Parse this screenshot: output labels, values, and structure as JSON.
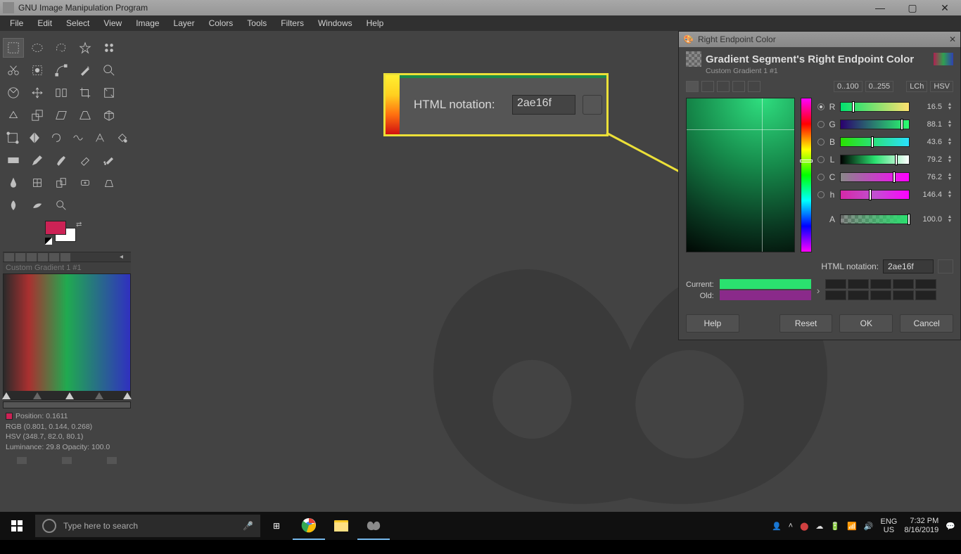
{
  "window": {
    "title": "GNU Image Manipulation Program"
  },
  "menu": [
    "File",
    "Edit",
    "Select",
    "View",
    "Image",
    "Layer",
    "Colors",
    "Tools",
    "Filters",
    "Windows",
    "Help"
  ],
  "gradient_editor": {
    "title": "Custom Gradient 1 #1",
    "position": "Position: 0.1611",
    "rgb": "RGB (0.801, 0.144, 0.268)",
    "hsv": "HSV (348.7, 82.0, 80.1)",
    "lum_op": "Luminance: 29.8   Opacity: 100.0"
  },
  "callout": {
    "label": "HTML notation:",
    "value": "2ae16f"
  },
  "color_dialog": {
    "window_title": "Right Endpoint Color",
    "header": "Gradient Segment's Right Endpoint Color",
    "sub": "Custom Gradient 1 #1",
    "range_a": "0..100",
    "range_b": "0..255",
    "mode_a": "LCh",
    "mode_b": "HSV",
    "channels": [
      {
        "k": "R",
        "v": "16.5",
        "cls": "r",
        "pos": "16%",
        "on": true
      },
      {
        "k": "G",
        "v": "88.1",
        "cls": "g",
        "pos": "88%",
        "on": false
      },
      {
        "k": "B",
        "v": "43.6",
        "cls": "b",
        "pos": "44%",
        "on": false
      },
      {
        "k": "L",
        "v": "79.2",
        "cls": "l",
        "pos": "79%",
        "on": false
      },
      {
        "k": "C",
        "v": "76.2",
        "cls": "c",
        "pos": "76%",
        "on": false
      },
      {
        "k": "h",
        "v": "146.4",
        "cls": "h",
        "pos": "41%",
        "on": false
      }
    ],
    "alpha": {
      "k": "A",
      "v": "100.0"
    },
    "html_label": "HTML notation:",
    "html_value": "2ae16f",
    "current_label": "Current:",
    "old_label": "Old:",
    "buttons": {
      "help": "Help",
      "reset": "Reset",
      "ok": "OK",
      "cancel": "Cancel"
    }
  },
  "taskbar": {
    "search_placeholder": "Type here to search",
    "lang1": "ENG",
    "lang2": "US",
    "time": "7:32 PM",
    "date": "8/16/2019"
  }
}
